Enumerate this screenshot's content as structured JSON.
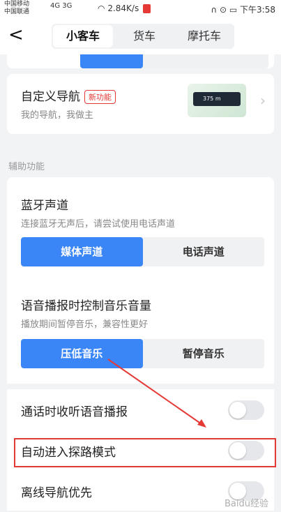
{
  "status": {
    "carrier1": "中国移动",
    "carrier2": "中国联通",
    "net": "4G 3G",
    "speed": "2.84K/s",
    "time": "下午3:58"
  },
  "header": {
    "back_glyph": "<",
    "tabs": [
      "小客车",
      "货车",
      "摩托车"
    ],
    "active_tab": 0
  },
  "top_card": {
    "options": [
      "",
      "",
      ""
    ]
  },
  "custom_nav": {
    "title": "自定义导航",
    "badge": "新功能",
    "subtitle": "我的导航，我做主",
    "thumb_text": "375 m"
  },
  "section": {
    "label": "辅助功能"
  },
  "bluetooth": {
    "title": "蓝牙声道",
    "subtitle": "连接蓝牙无声后，请尝试使用电话声道",
    "options": [
      "媒体声道",
      "电话声道"
    ],
    "selected": 0
  },
  "music_control": {
    "title": "语音播报时控制音乐音量",
    "subtitle": "播放期间暂停音乐，兼容性更好",
    "options": [
      "压低音乐",
      "暂停音乐"
    ],
    "selected": 0
  },
  "toggles": [
    {
      "label": "通话时收听语音播报",
      "on": false
    },
    {
      "label": "自动进入探路模式",
      "on": false
    },
    {
      "label": "离线导航优先",
      "on": false
    }
  ],
  "watermark": "Baidu经验",
  "colors": {
    "accent": "#3b86f6",
    "annotation": "#e53935"
  }
}
